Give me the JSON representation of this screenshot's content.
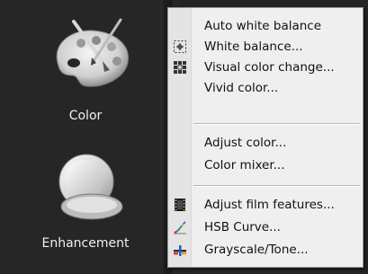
{
  "tools": [
    {
      "label": "Color",
      "icon": "palette-icon"
    },
    {
      "label": "Enhancement",
      "icon": "compact-mirror-icon"
    }
  ],
  "menu": {
    "items": [
      {
        "label": "Auto white balance",
        "icon": ""
      },
      {
        "label": "White balance...",
        "icon": "eyedropper-target-icon"
      },
      {
        "label": "Visual color change...",
        "icon": "color-grid-icon"
      },
      {
        "label": "Vivid color...",
        "icon": ""
      },
      {
        "label": "Adjust color...",
        "icon": ""
      },
      {
        "label": "Color mixer...",
        "icon": ""
      },
      {
        "label": "Adjust film features...",
        "icon": "film-icon"
      },
      {
        "label": "HSB Curve...",
        "icon": "curve-icon"
      },
      {
        "label": "Grayscale/Tone...",
        "icon": "grayscale-icon"
      }
    ]
  }
}
